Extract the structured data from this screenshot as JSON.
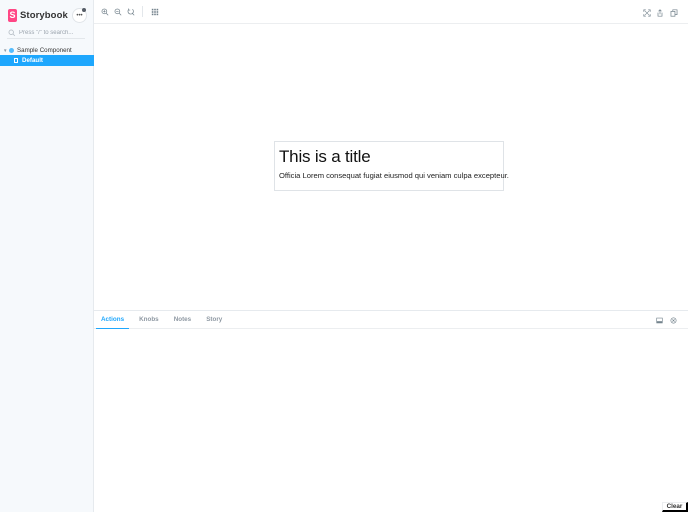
{
  "sidebar": {
    "brand": {
      "logo_letter": "S",
      "name": "Storybook"
    },
    "menu_icon": "ellipsis-icon",
    "search": {
      "placeholder": "Press \"/\" to search..."
    },
    "tree": {
      "group_label": "Sample Component",
      "items": [
        {
          "label": "Default",
          "selected": true
        }
      ]
    }
  },
  "toolbar": {
    "left_icons": [
      "zoom-in-icon",
      "zoom-out-icon",
      "zoom-reset-icon",
      "grid-icon"
    ],
    "right_icons": [
      "fullscreen-icon",
      "share-icon",
      "copy-icon"
    ]
  },
  "canvas": {
    "title": "This is a title",
    "body": "Officia Lorem consequat fugiat eiusmod qui veniam culpa excepteur."
  },
  "panel": {
    "tabs": [
      {
        "label": "Actions",
        "active": true
      },
      {
        "label": "Knobs",
        "active": false
      },
      {
        "label": "Notes",
        "active": false
      },
      {
        "label": "Story",
        "active": false
      }
    ],
    "right_icons": [
      "panel-bottom-icon",
      "close-circle-icon"
    ],
    "clear_label": "Clear"
  },
  "colors": {
    "accent": "#1ea7fd",
    "brand": "#ff4785",
    "sidebar_bg": "#f6f9fc"
  }
}
